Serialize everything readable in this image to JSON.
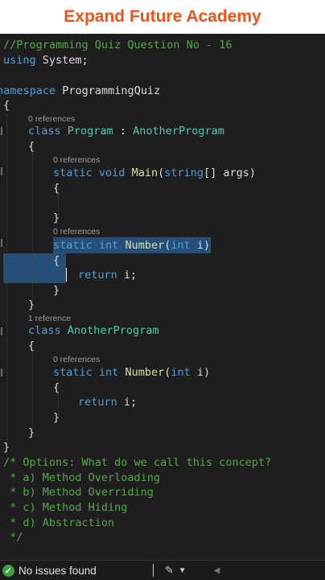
{
  "banner": {
    "title": "Expand Future Academy"
  },
  "code": {
    "l1": "//Programming Quiz Question No - 16",
    "l2_kw": "using",
    "l2_rest": " System;",
    "l3_kw": "namespace",
    "l3_rest": " ProgrammingQuiz",
    "brace_open": "{",
    "brace_close": "}",
    "lens_program": "0 references",
    "l5_kw": "class",
    "l5_name": "Program",
    "l5_colon": " : ",
    "l5_base": "AnotherProgram",
    "lens_main": "0 references",
    "l7_kw1": "static",
    "l7_kw2": "void",
    "l7_fn": "Main",
    "l7_p1": "(",
    "l7_type": "string",
    "l7_rest": "[] args)",
    "lens_number1": "0 references",
    "l11_kw1": "static",
    "l11_kw2": "int",
    "l11_fn": "Number",
    "l11_p": "(",
    "l11_ptype": "int",
    "l11_rest": " i)",
    "l13_kw": "return",
    "l13_rest": " i;",
    "lens_another": "1 reference",
    "l16_kw": "class",
    "l16_name": "AnotherProgram",
    "lens_number2": "0 references",
    "l18_kw1": "static",
    "l18_kw2": "int",
    "l18_fn": "Number",
    "l18_p": "(",
    "l18_ptype": "int",
    "l18_rest": " i)",
    "l20_kw": "return",
    "l20_rest": " i;",
    "c1": "/* Options: What do we call this concept?",
    "c2": " * a) Method Overloading",
    "c3": " * b) Method Overriding",
    "c4": " * c) Method Hiding",
    "c5": " * d) Abstraction",
    "c6": " */"
  },
  "status": {
    "issues_label": "No issues found",
    "ok_icon": "check-circle-icon",
    "brush_icon": "brush-icon"
  },
  "colors": {
    "keyword": "#569cd6",
    "class": "#4ec9b0",
    "function": "#dcdcaa",
    "comment": "#57a64a",
    "selection": "#264f78",
    "banner_text": "#e8551e"
  }
}
